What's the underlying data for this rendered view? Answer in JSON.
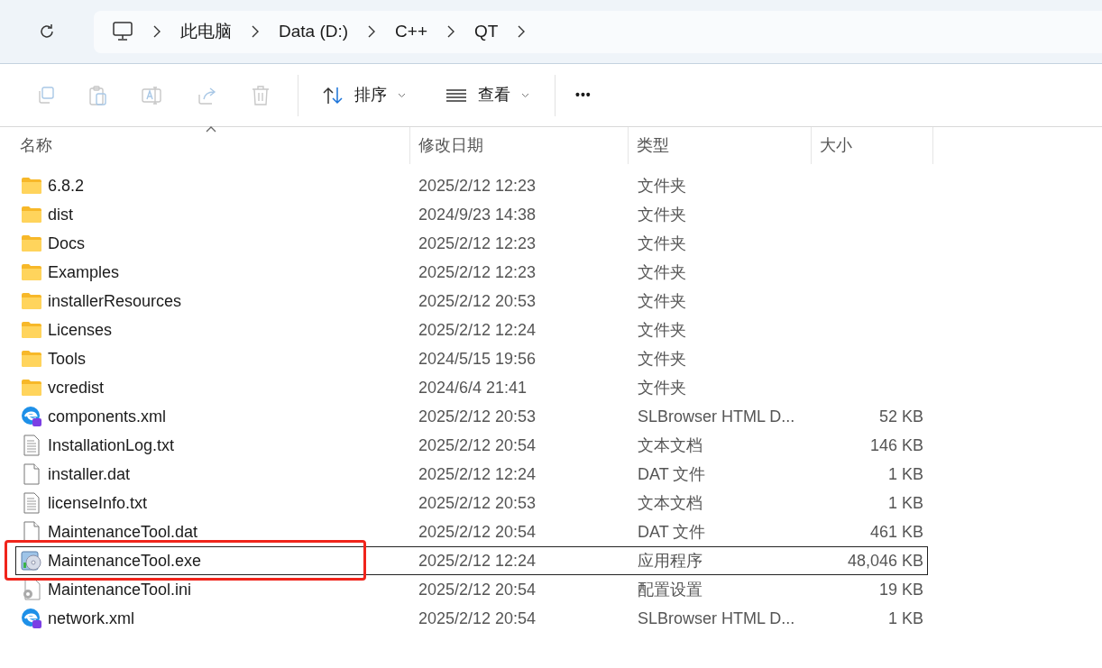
{
  "breadcrumb": [
    "此电脑",
    "Data (D:)",
    "C++",
    "QT"
  ],
  "toolbar": {
    "sort": "排序",
    "view": "查看",
    "more": "•••"
  },
  "columns": [
    "名称",
    "修改日期",
    "类型",
    "大小"
  ],
  "rows": [
    {
      "name": "6.8.2",
      "date": "2025/2/12 12:23",
      "type": "文件夹",
      "size": "",
      "kind": "folder",
      "selected": false
    },
    {
      "name": "dist",
      "date": "2024/9/23 14:38",
      "type": "文件夹",
      "size": "",
      "kind": "folder",
      "selected": false
    },
    {
      "name": "Docs",
      "date": "2025/2/12 12:23",
      "type": "文件夹",
      "size": "",
      "kind": "folder",
      "selected": false
    },
    {
      "name": "Examples",
      "date": "2025/2/12 12:23",
      "type": "文件夹",
      "size": "",
      "kind": "folder",
      "selected": false
    },
    {
      "name": "installerResources",
      "date": "2025/2/12 20:53",
      "type": "文件夹",
      "size": "",
      "kind": "folder",
      "selected": false
    },
    {
      "name": "Licenses",
      "date": "2025/2/12 12:24",
      "type": "文件夹",
      "size": "",
      "kind": "folder",
      "selected": false
    },
    {
      "name": "Tools",
      "date": "2024/5/15 19:56",
      "type": "文件夹",
      "size": "",
      "kind": "folder",
      "selected": false
    },
    {
      "name": "vcredist",
      "date": "2024/6/4 21:41",
      "type": "文件夹",
      "size": "",
      "kind": "folder",
      "selected": false
    },
    {
      "name": "components.xml",
      "date": "2025/2/12 20:53",
      "type": "SLBrowser HTML D...",
      "size": "52 KB",
      "kind": "browser",
      "selected": false
    },
    {
      "name": "InstallationLog.txt",
      "date": "2025/2/12 20:54",
      "type": "文本文档",
      "size": "146 KB",
      "kind": "text",
      "selected": false
    },
    {
      "name": "installer.dat",
      "date": "2025/2/12 12:24",
      "type": "DAT 文件",
      "size": "1 KB",
      "kind": "blank",
      "selected": false
    },
    {
      "name": "licenseInfo.txt",
      "date": "2025/2/12 20:53",
      "type": "文本文档",
      "size": "1 KB",
      "kind": "text",
      "selected": false
    },
    {
      "name": "MaintenanceTool.dat",
      "date": "2025/2/12 20:54",
      "type": "DAT 文件",
      "size": "461 KB",
      "kind": "blank",
      "selected": false
    },
    {
      "name": "MaintenanceTool.exe",
      "date": "2025/2/12 12:24",
      "type": "应用程序",
      "size": "48,046 KB",
      "kind": "app",
      "selected": true
    },
    {
      "name": "MaintenanceTool.ini",
      "date": "2025/2/12 20:54",
      "type": "配置设置",
      "size": "19 KB",
      "kind": "settings",
      "selected": false
    },
    {
      "name": "network.xml",
      "date": "2025/2/12 20:54",
      "type": "SLBrowser HTML D...",
      "size": "1 KB",
      "kind": "browser",
      "selected": false
    }
  ]
}
